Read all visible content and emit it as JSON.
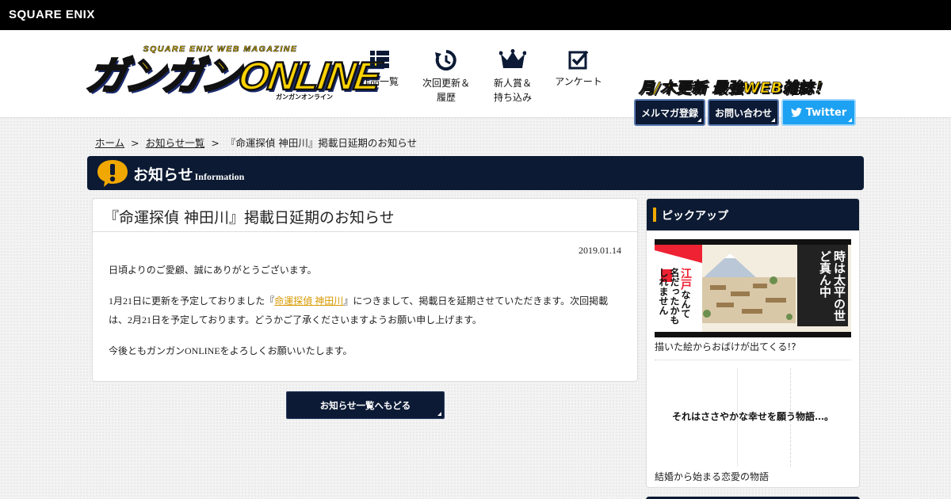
{
  "topbar": {
    "brand": "SQUARE ENIX"
  },
  "header": {
    "logo": {
      "magazine": "SQUARE ENIX WEB MAGAZINE",
      "title": "ガンガンONLINE",
      "kana": "ガンガンオンライン"
    },
    "nav": [
      {
        "line1": "作品一覧",
        "line2": "",
        "icon": "grid-list-icon"
      },
      {
        "line1": "次回更新＆",
        "line2": "履歴",
        "icon": "clock-refresh-icon"
      },
      {
        "line1": "新人賞＆",
        "line2": "持ち込み",
        "icon": "crown-icon"
      },
      {
        "line1": "アンケート",
        "line2": "",
        "icon": "checkbox-icon"
      }
    ],
    "catchphrase": "月/木更新 最強WEB雑誌！",
    "buttons": {
      "mailmag": "メルマガ登録",
      "contact": "お問い合わせ",
      "twitter": "Twitter"
    }
  },
  "breadcrumb": {
    "home": "ホーム",
    "sep": ">",
    "list": "お知らせ一覧",
    "current": "『命運探偵 神田川』掲載日延期のお知らせ"
  },
  "section": {
    "title": "お知らせ",
    "subtitle": "Information"
  },
  "article": {
    "title": "『命運探偵 神田川』掲載日延期のお知らせ",
    "date": "2019.01.14",
    "p1": "日頃よりのご愛顧、誠にありがとうございます。",
    "p2_before": "1月21日に更新を予定しておりました『",
    "p2_link": "命運探偵 神田川",
    "p2_after": "』につきまして、掲載日を延期させていただきます。次回掲載は、2月21日を予定しております。どうかご了承くださいますようお願い申し上げます。",
    "p3": "今後ともガンガンONLINEをよろしくお願いいたします。"
  },
  "back_button": "お知らせ一覧へもどる",
  "pickup": {
    "heading": "ピックアップ",
    "items": [
      {
        "caption": "描いた絵からおばけが出てくる!?",
        "banner_right": "時は太平の世",
        "banner_right2": "ど真ん中",
        "banner_left1": "江戸",
        "banner_left2": "なんて",
        "banner_left3": "名だったかも",
        "banner_left4": "しれません"
      },
      {
        "caption": "結婚から始まる恋愛の物語",
        "banner_text": "それはささやかな幸せを願う物語…。"
      }
    ]
  },
  "colors": {
    "navy": "#0c1a33",
    "yellow": "#fcd200",
    "twitter": "#1da1f2",
    "link": "#d89a00",
    "accent": "#f0a800"
  }
}
